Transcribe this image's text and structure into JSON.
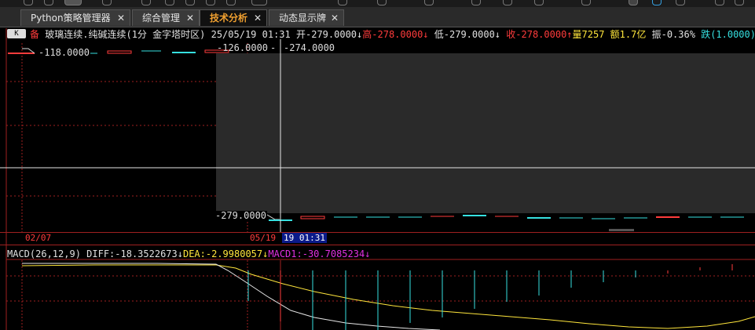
{
  "tabs": [
    {
      "label": "Python策略管理器",
      "active": false
    },
    {
      "label": "综合管理",
      "active": false
    },
    {
      "label": "技术分析",
      "active": true
    },
    {
      "label": "动态显示牌",
      "active": false
    }
  ],
  "close_glyph": "✕",
  "chart_type_button": "K",
  "quote": {
    "tag": "备",
    "name": "玻璃连续.纯碱连续(1分 金字塔时区)",
    "datetime": "25/05/19 01:31",
    "open": "开-279.0000",
    "open_arrow": "↓",
    "high": "高-278.0000",
    "high_arrow": "↓",
    "low": "低-279.0000",
    "low_arrow": "↓",
    "close": "收-278.0000",
    "close_arrow": "↑",
    "volume": "量7257",
    "amount": "额1.7亿",
    "amplitude": "振-0.36%",
    "change": "跌(1.0000)"
  },
  "price_labels": {
    "left_top": "-118.0000",
    "mid_top": "-126.0000",
    "crosshair_top": "-274.0000",
    "mid_bottom": "-279.0000",
    "separator": "-"
  },
  "time_labels": {
    "left": "02/07",
    "mid": "05/19",
    "selected": "19 01:31"
  },
  "macd": {
    "title": "MACD(26,12,9)",
    "diff": "DIFF:-18.3522673",
    "diff_arrow": "↓",
    "dea": "DEA:-2.9980057",
    "dea_arrow": "↓",
    "macd1": "MACD1:-30.7085234",
    "macd1_arrow": "↓"
  },
  "colors": {
    "up": "#ff3c3c",
    "down": "#36e0e0",
    "volume": "#ffe63c",
    "macd1": "#e030e0",
    "grid_red": "#a02020",
    "tab_active": "#f0a030"
  }
}
